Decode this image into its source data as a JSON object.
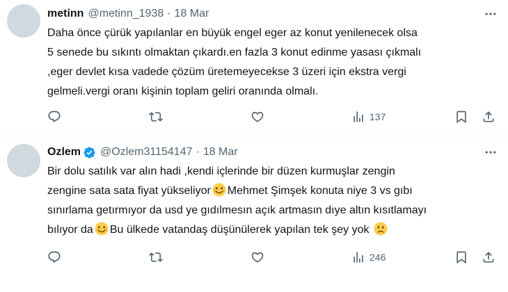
{
  "tweets": [
    {
      "author_name": "metinn",
      "handle": "@metinn_1938",
      "separator": "·",
      "date": "18 Mar",
      "verified": false,
      "lines": [
        "Daha önce çürük yapılanlar en büyük engel eger az konut yenilenecek olsa",
        "5 senede bu sıkıntı olmaktan çıkardı.en fazla 3 konut edinme yasası çıkmalı",
        ",eger devlet kısa vadede çözüm üretemeyecekse 3 üzeri için ekstra vergi",
        "gelmeli.vergi oranı kişinin toplam geliri oranında olmalı."
      ],
      "views": "137"
    },
    {
      "author_name": "Ozlem",
      "handle": "@Ozlem31154147",
      "separator": "·",
      "date": "18 Mar",
      "verified": true,
      "lines_segments": {
        "l1": "Bir dolu satılık var alın hadi ,kendi içlerinde bir düzen kurmuşlar zengin",
        "l2a": "zengine sata sata fiyat yükseliyor",
        "l2b": "Mehmet Şimşek konuta niye 3 vs gıbı",
        "l3": "sınırlama getırmıyor da usd ye gıdılmesın açık artmasın dıye altın kısıtlamayı",
        "l4a": "bılıyor da",
        "l4b": "Bu ülkede vatandaş düşünülerek yapılan tek şey yok"
      },
      "views": "246"
    }
  ],
  "icons": {
    "more": "more-horizontal-icon",
    "reply": "reply-icon",
    "retweet": "retweet-icon",
    "like": "heart-icon",
    "views": "views-icon",
    "bookmark": "bookmark-icon",
    "share": "share-icon",
    "verified": "verified-badge-icon",
    "emoji_smile": "smiling-face-emoji",
    "emoji_sad": "slightly-frowning-face-emoji"
  },
  "colors": {
    "text": "#0f1419",
    "secondary": "#536471",
    "verified": "#1d9bf0",
    "avatar_placeholder": "#cfd9de",
    "divider": "#eff3f4",
    "emoji": "#ffcc4d"
  }
}
